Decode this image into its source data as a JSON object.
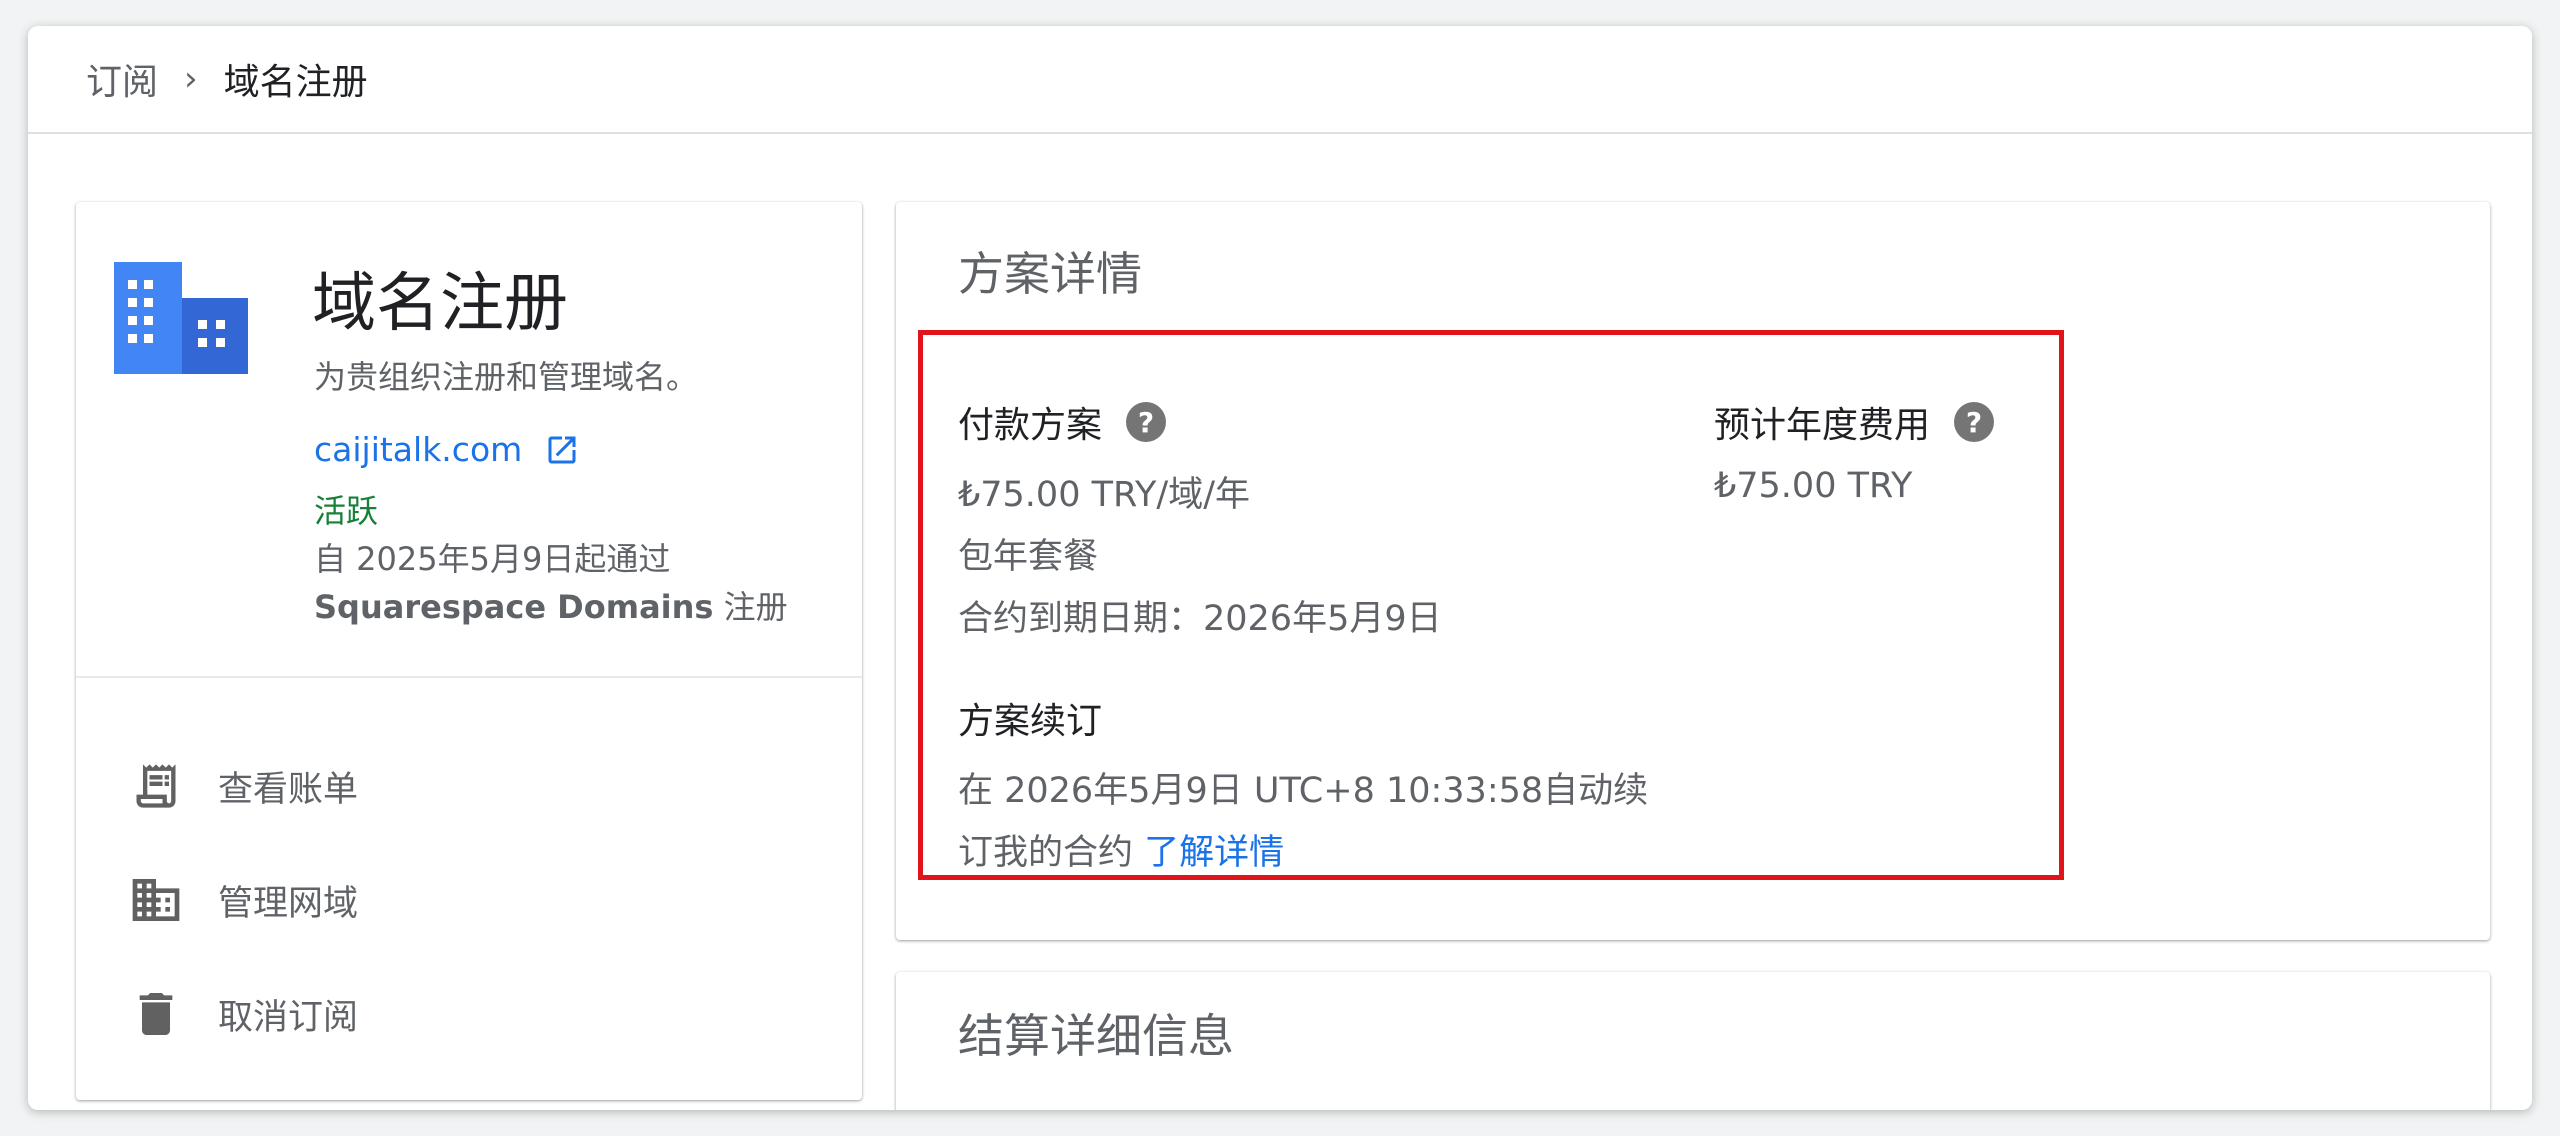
{
  "breadcrumb": {
    "parent": "订阅",
    "separator": "›",
    "current": "域名注册"
  },
  "product": {
    "title": "域名注册",
    "description": "为贵组织注册和管理域名。",
    "domain": "caijitalk.com",
    "status": "活跃",
    "registration_line1": "自 2025年5月9日起通过",
    "registrar": "Squarespace Domains",
    "registration_suffix": " 注册"
  },
  "actions": [
    {
      "label": "查看账单",
      "icon": "receipt-icon"
    },
    {
      "label": "管理网域",
      "icon": "building-icon"
    },
    {
      "label": "取消订阅",
      "icon": "trash-icon"
    }
  ],
  "plan": {
    "title": "方案详情",
    "payment_plan_label": "付款方案",
    "price": "₺75.00 TRY/域/年",
    "plan_type": "包年套餐",
    "contract_end": "合约到期日期：2026年5月9日",
    "annual_cost_label": "预计年度费用",
    "annual_cost": "₺75.00 TRY",
    "renewal_label": "方案续订",
    "renewal_line1": "在 2026年5月9日 UTC+8 10:33:58自动续",
    "renewal_line2": "订我的合约",
    "learn_more": "了解详情"
  },
  "billing": {
    "title": "结算详细信息"
  },
  "colors": {
    "link": "#1a73e8",
    "active": "#188038",
    "highlight": "#e0141b",
    "icon_blue": "#4285f4"
  }
}
